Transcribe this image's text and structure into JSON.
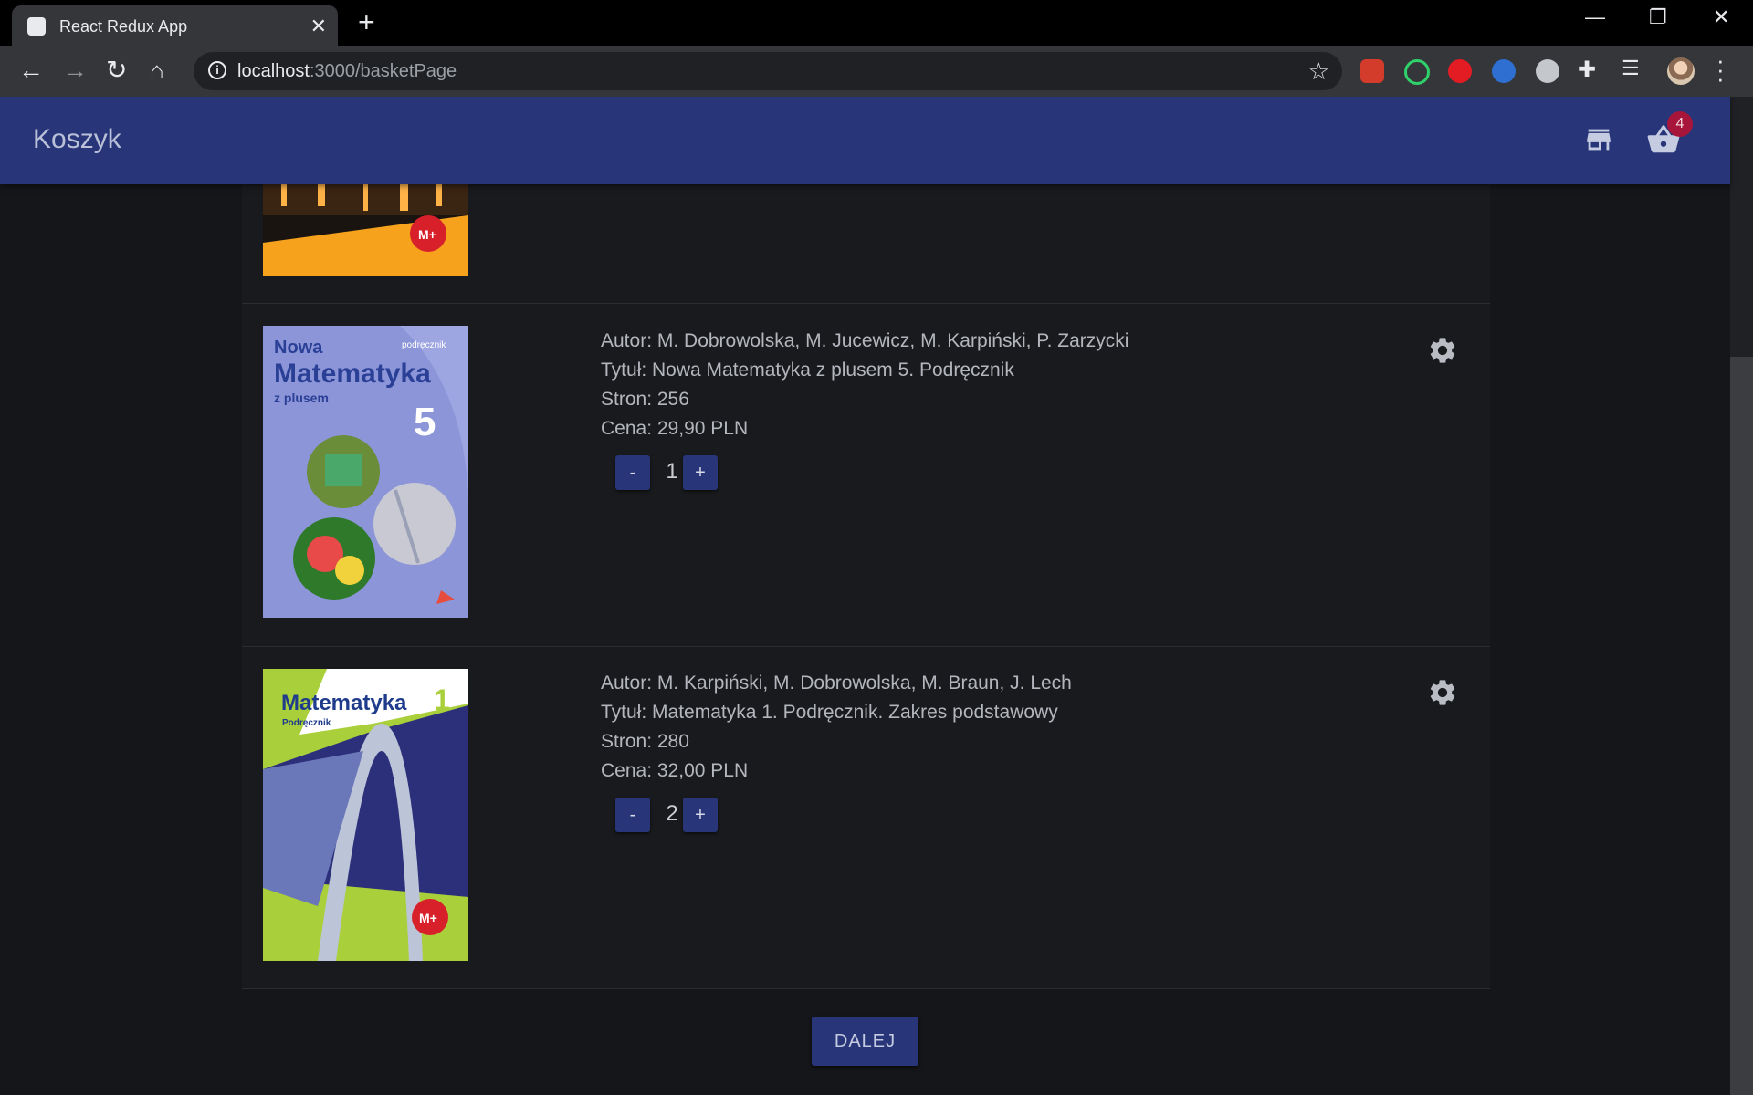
{
  "browser": {
    "tab_title": "React Redux App",
    "tab_close": "✕",
    "new_tab": "+",
    "url_host": "localhost",
    "url_path": ":3000/basketPage",
    "window_controls": [
      "—",
      "❐",
      "✕"
    ]
  },
  "appbar": {
    "title": "Koszyk",
    "basket_count": "4"
  },
  "books": [
    {
      "author": "Autor: M. Dobrowolska, M. Jucewicz, M. Karpiński, P. Zarzycki",
      "title": "Tytuł: Nowa Matematyka z plusem 5. Podręcznik",
      "pages": "Stron: 256",
      "price": "Cena: 29,90 PLN",
      "quantity": "1",
      "cover": {
        "line1": "Nowa",
        "line2": "Matematyka",
        "line3": "z plusem",
        "number": "5",
        "tag": "podręcznik"
      }
    },
    {
      "author": "Autor: M. Karpiński, M. Dobrowolska, M. Braun, J. Lech",
      "title": "Tytuł: Matematyka 1. Podręcznik. Zakres podstawowy",
      "pages": "Stron: 280",
      "price": "Cena: 32,00 PLN",
      "quantity": "2",
      "cover": {
        "line1": "Matematyka",
        "number": "1",
        "tag": "Podręcznik"
      }
    }
  ],
  "controls": {
    "minus": "-",
    "plus": "+",
    "next_label": "DALEJ"
  },
  "colors": {
    "appbar": "#283679",
    "badge": "#a8153a",
    "background": "#151619"
  }
}
